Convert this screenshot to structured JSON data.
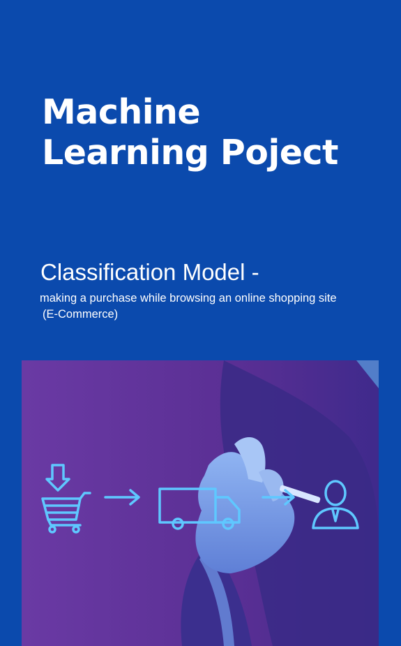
{
  "title": {
    "line1": "Machine",
    "line2": "Learning Poject"
  },
  "subtitle": "Classification Model -",
  "description": {
    "line1": "making a purchase while browsing an online shopping site",
    "line2": "(E-Commerce)"
  },
  "colors": {
    "background": "#0b4aad",
    "photo_tint": "#5a2f96",
    "icon_line": "#5fc8ff"
  },
  "illustration": {
    "icons": [
      "download-arrow-icon",
      "shopping-cart-icon",
      "right-arrow-icon",
      "delivery-truck-icon",
      "right-arrow-icon",
      "customer-icon"
    ]
  }
}
